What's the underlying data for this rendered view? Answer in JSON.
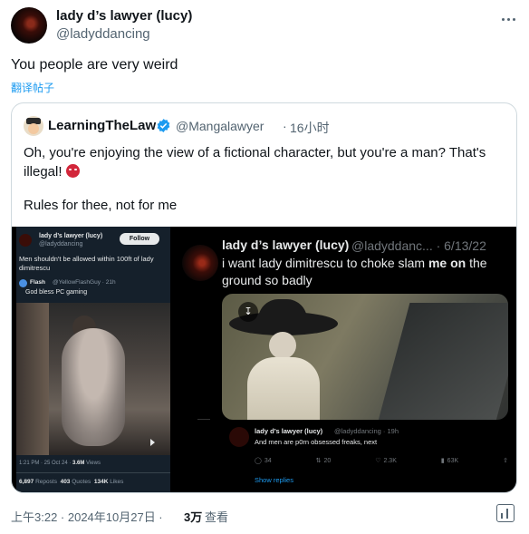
{
  "post": {
    "author_name": "lady d’s lawyer (lucy)",
    "author_handle": "@ladyddancing",
    "text": "You people are very weird",
    "translate_label": "翻译帖子",
    "timestamp": "上午3:22 · 2024年10月27日 ·",
    "views_count": "3万",
    "views_label": "查看"
  },
  "quote": {
    "author_name": "LearningTheLaw",
    "author_handle": "@Mangalawyer",
    "separator": "·",
    "time": "16小时",
    "text_line1": "Oh, you're enjoying the view of a fictional character, but you're a man? That's illegal!",
    "text_line2": "Rules for thee, not for me"
  },
  "media_left": {
    "author_name": "lady d’s lawyer (lucy)",
    "author_handle": "@ladyddancing",
    "follow_label": "Follow",
    "text": "Men shouldn't be allowed within 100ft of lady dimitrescu",
    "quoted_name": "Flash",
    "quoted_handle": "@YellowFlashGuy · 21h",
    "quoted_text": "God bless PC gaming",
    "meta_time": "1:21 PM · 25 Oct 24 ·",
    "meta_views": "3.6M",
    "meta_views_label": "Views",
    "reposts": "6,897",
    "reposts_label": "Reposts",
    "quotes": "403",
    "quotes_label": "Quotes",
    "likes": "134K",
    "likes_label": "Likes"
  },
  "media_right": {
    "author_name": "lady d’s lawyer (lucy)",
    "author_handle": "@ladyddanc... · 6/13/22",
    "text_before": "i want lady dimitrescu to choke slam",
    "text_bold": "me on",
    "text_after": "the ground so badly",
    "reply_name": "lady d’s lawyer (lucy)",
    "reply_handle": "@ladyddancing · 19h",
    "reply_text": "And men are p0rn obsessed freaks, next",
    "action_replies": "34",
    "action_reposts": "20",
    "action_likes": "2.3K",
    "action_views": "63K",
    "show_replies_label": "Show replies"
  },
  "colors": {
    "accent": "#1d9bf0",
    "muted": "#536471",
    "verified": "#1d9bf0"
  }
}
